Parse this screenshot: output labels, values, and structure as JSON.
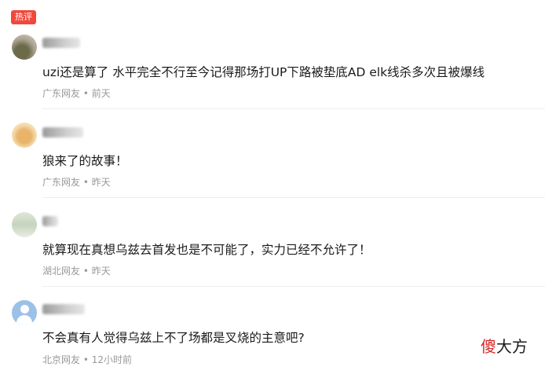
{
  "section_badge": "热评",
  "accent_color": "#f2483b",
  "comments": [
    {
      "username": "",
      "text": "uzi还是算了 水平完全不行至今记得那场打UP下路被垫底AD elk线杀多次且被爆线",
      "location": "广东网友",
      "time": "前天",
      "avatar": "user-photo-avatar"
    },
    {
      "username": "",
      "text": "狼来了的故事！",
      "location": "广东网友",
      "time": "昨天",
      "avatar": "dog-photo-avatar"
    },
    {
      "username": "",
      "text": "就算现在真想乌兹去首发也是不可能了，实力已经不允许了！",
      "location": "湖北网友",
      "time": "昨天",
      "avatar": "user-photo-avatar"
    },
    {
      "username": "",
      "text": "不会真有人觉得乌兹上不了场都是叉烧的主意吧?",
      "location": "北京网友",
      "time": "12小时前",
      "avatar": "default-user-icon"
    }
  ],
  "separator": "•",
  "watermark": {
    "part1": "傻",
    "part2": "大方"
  }
}
